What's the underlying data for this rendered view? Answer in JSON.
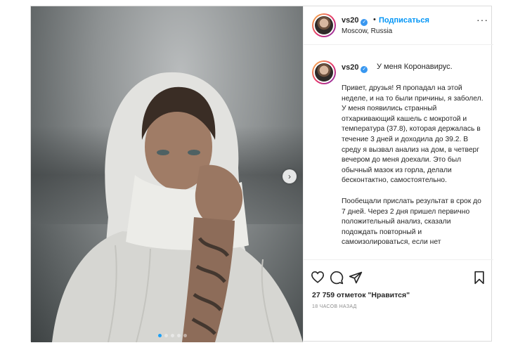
{
  "post": {
    "username": "vs20",
    "verified_mark": "✓",
    "header_sep": "•",
    "follow_label": "Подписаться",
    "location": "Moscow, Russia",
    "more_label": "···",
    "caption_title": "У меня Коронавирус.",
    "paragraphs": [
      "Привет, друзья! Я пропадал на этой неделе, и на то были причины, я заболел. У меня появились странный отхаркивающий кашель с мокротой и температура (37.8), которая держалась в течение 3 дней и доходила до 39.2. В среду я вызвал анализ на дом, в четверг вечером до меня доехали. Это был обычный мазок из горла, делали бесконтактно, самостоятельно.",
      "Пообещали прислать результат в срок до 7 дней. Через 2 дня пришел первично положительный анализ, сказали подождать повторный и самоизолироваться, если нет"
    ],
    "likes": "27 759 отметок \"Нравится\"",
    "time": "18 ЧАСОВ НАЗАД",
    "slide_arrow": "›",
    "carousel": {
      "count": 5,
      "active": 0
    },
    "colors": {
      "link": "#0095f6",
      "verified": "#3897f0",
      "text": "#262626",
      "muted": "#8e8e8e"
    }
  },
  "icons": {
    "like": "heart-icon",
    "comment": "comment-icon",
    "share": "share-icon",
    "save": "bookmark-icon",
    "more": "more-icon"
  }
}
